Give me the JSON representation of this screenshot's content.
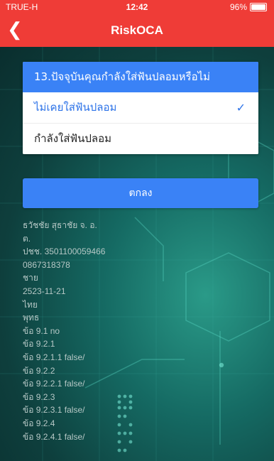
{
  "status_bar": {
    "carrier": "TRUE-H",
    "time": "12:42",
    "battery": "96%",
    "battery_level": 0.96
  },
  "nav": {
    "back_icon": "chevron-left-icon",
    "title": "RiskOCA"
  },
  "question": {
    "title": "13.ปัจจุบันคุณกำลังใส่ฟันปลอมหรือไม่",
    "options": [
      {
        "label": "ไม่เคยใส่ฟันปลอม",
        "selected": true
      },
      {
        "label": "กำลังใส่ฟันปลอม",
        "selected": false
      }
    ],
    "check_icon": "check-icon"
  },
  "ok_button": {
    "label": "ตกลง"
  },
  "info_lines": [
    "ธวัชชัย สุธาชัย จ. อ.",
    "ต.",
    "ปชช. 3501100059466",
    "0867318378",
    "ชาย",
    "2523-11-21",
    "ไทย",
    "พุทธ",
    "ข้อ 9.1 no",
    "ข้อ 9.2.1",
    "ข้อ 9.2.1.1 false/",
    "ข้อ 9.2.2",
    "ข้อ 9.2.2.1 false/",
    "ข้อ 9.2.3",
    "ข้อ 9.2.3.1 false/",
    "ข้อ 9.2.4",
    "ข้อ 9.2.4.1 false/"
  ],
  "colors": {
    "header": "#ef3c37",
    "accent": "#3a82f6",
    "selected_text": "#2d73e8"
  }
}
